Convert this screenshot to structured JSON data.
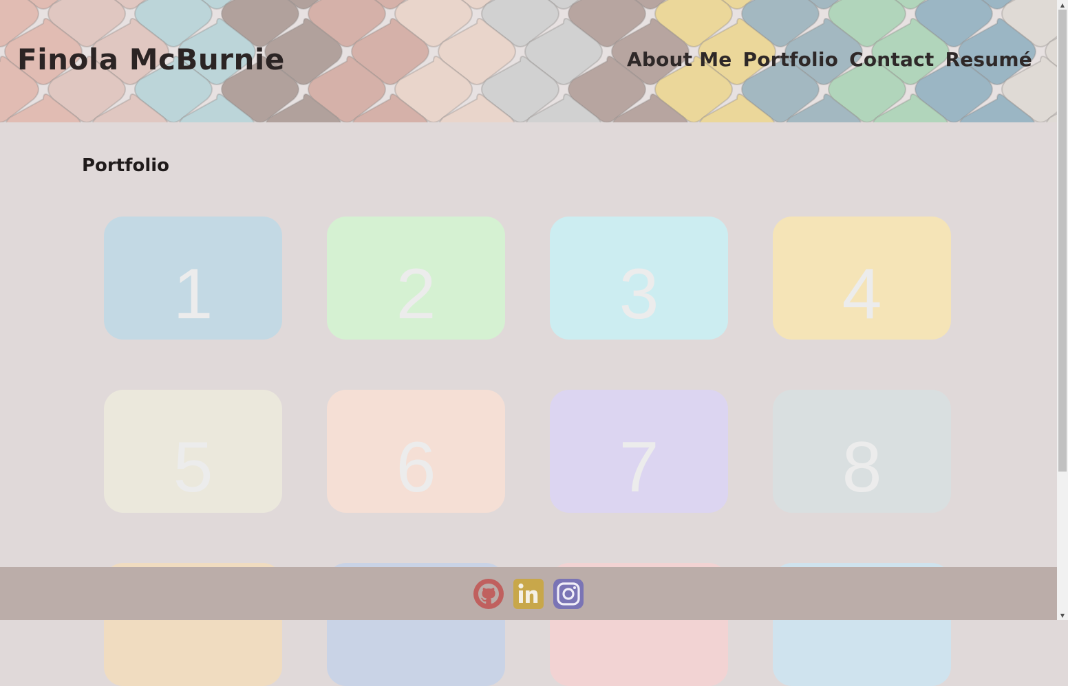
{
  "header": {
    "title": "Finola McBurnie",
    "nav": [
      "About Me",
      "Portfolio",
      "Contact",
      "Resumé"
    ]
  },
  "portfolio": {
    "heading": "Portfolio",
    "tiles": [
      {
        "label": "1",
        "color": "#c3d9e4"
      },
      {
        "label": "2",
        "color": "#d5f1d2"
      },
      {
        "label": "3",
        "color": "#ccedf1"
      },
      {
        "label": "4",
        "color": "#f5e4b7"
      },
      {
        "label": "5",
        "color": "#ebe8dc"
      },
      {
        "label": "6",
        "color": "#f5dfd5"
      },
      {
        "label": "7",
        "color": "#dcd5f1"
      },
      {
        "label": "8",
        "color": "#d9dfe0"
      }
    ]
  },
  "footer": {
    "icons": [
      {
        "name": "github-icon",
        "color": "#c0605e"
      },
      {
        "name": "linkedin-icon",
        "color": "#c8a74a"
      },
      {
        "name": "instagram-icon",
        "color": "#7a74b5"
      }
    ]
  }
}
